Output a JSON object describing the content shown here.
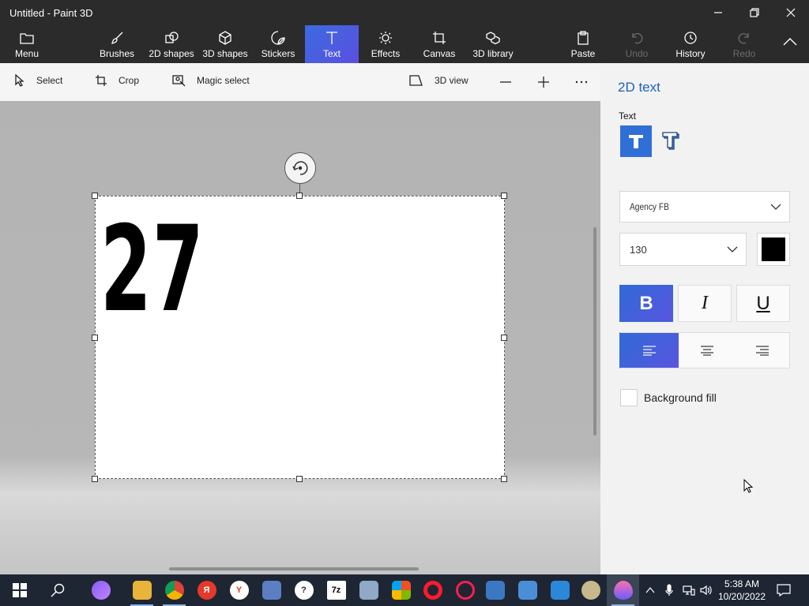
{
  "window": {
    "title": "Untitled - Paint 3D"
  },
  "ribbon": {
    "menu": "Menu",
    "items": [
      "Brushes",
      "2D shapes",
      "3D shapes",
      "Stickers",
      "Text",
      "Effects",
      "Canvas",
      "3D library"
    ],
    "active": "Text",
    "paste": "Paste",
    "undo": "Undo",
    "history": "History",
    "redo": "Redo"
  },
  "toolbar": {
    "select": "Select",
    "crop": "Crop",
    "magic_select": "Magic select",
    "view_3d": "3D view"
  },
  "canvas": {
    "text": "27"
  },
  "panel": {
    "title": "2D text",
    "text_label": "Text",
    "font": "Agency FB",
    "size": "130",
    "color": "#000000",
    "bold": "B",
    "italic": "I",
    "underline": "U",
    "background_fill": "Background fill",
    "background_fill_checked": false
  },
  "taskbar": {
    "time": "5:38 AM",
    "date": "10/20/2022",
    "apps": [
      "alice",
      "file-explorer",
      "chrome",
      "yandex-browser",
      "yandex",
      "calculator",
      "feedback-hub",
      "7zip",
      "photos",
      "store",
      "opera",
      "opera-gx",
      "control-panel",
      "remote-desktop",
      "people",
      "paint",
      "paint-3d"
    ]
  },
  "colors": {
    "accent": "#2f6fd6",
    "ribbon": "#2b2b2b",
    "panel_title": "#1f5fbf",
    "taskbar": "#1e2633"
  }
}
